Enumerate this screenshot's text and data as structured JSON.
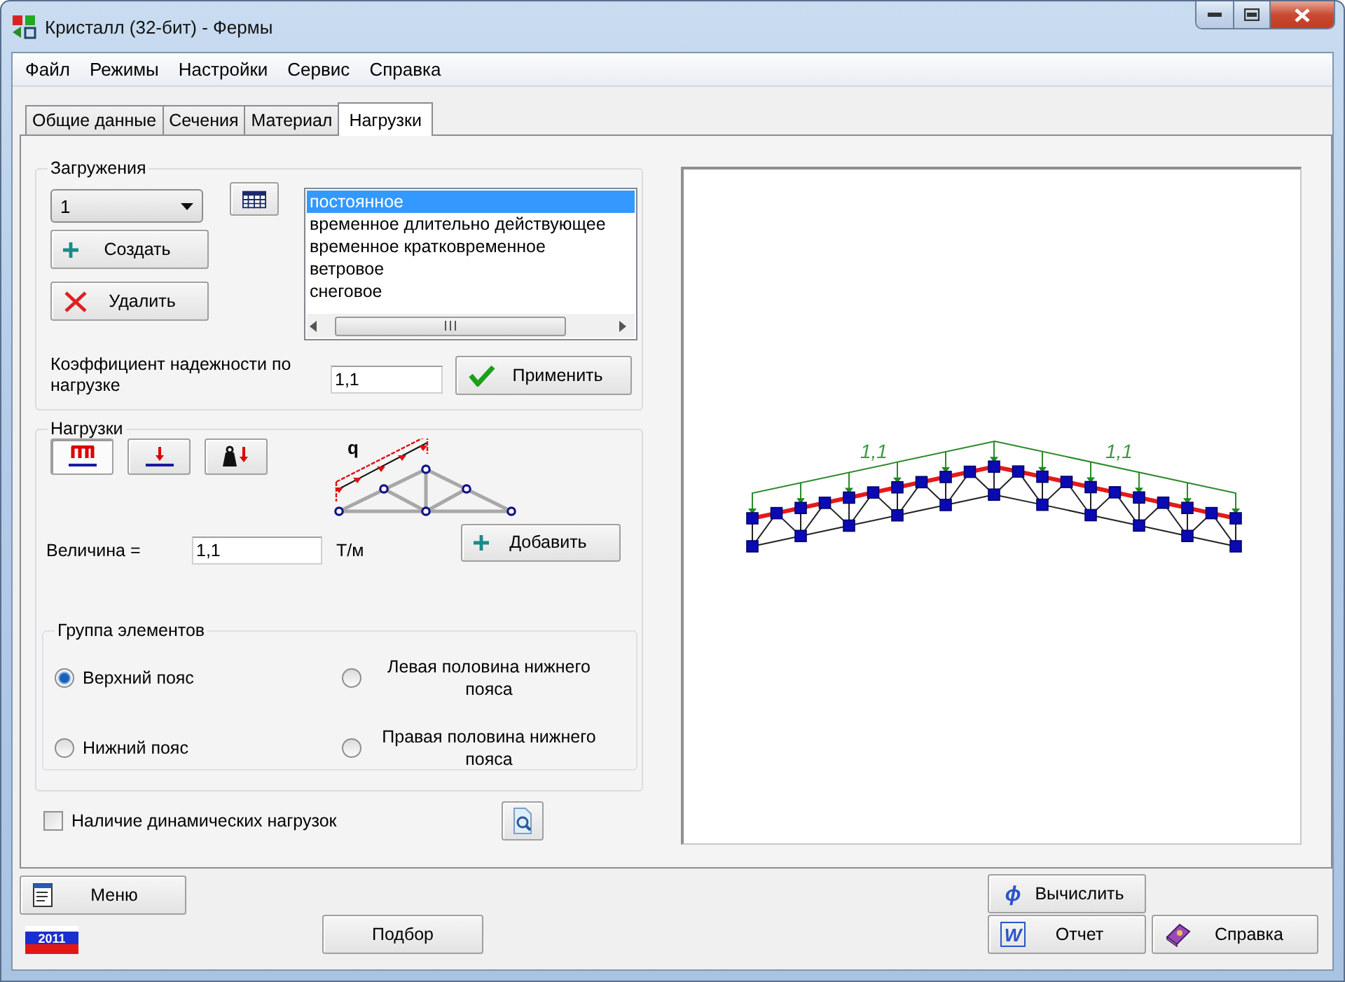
{
  "window": {
    "title": "Кристалл (32-бит) - Фермы"
  },
  "menu": [
    "Файл",
    "Режимы",
    "Настройки",
    "Сервис",
    "Справка"
  ],
  "tabs": [
    {
      "label": "Общие данные",
      "selected": false
    },
    {
      "label": "Сечения",
      "selected": false
    },
    {
      "label": "Материал",
      "selected": false
    },
    {
      "label": "Нагрузки",
      "selected": true
    }
  ],
  "loadings": {
    "title": "Загружения",
    "combo_value": "1",
    "create_button": "Создать",
    "delete_button": "Удалить",
    "load_types": [
      {
        "label": "постоянное",
        "selected": true
      },
      {
        "label": "временное длительно действующее",
        "selected": false
      },
      {
        "label": "временное кратковременное",
        "selected": false
      },
      {
        "label": "ветровое",
        "selected": false
      },
      {
        "label": "снеговое",
        "selected": false
      }
    ],
    "factor_label": "Коэффициент надежности по нагрузке",
    "factor_value": "1,1",
    "apply_button": "Применить"
  },
  "loads": {
    "title": "Нагрузки",
    "load_kinds": [
      {
        "kind": "distributed",
        "selected": true
      },
      {
        "kind": "point",
        "selected": false
      },
      {
        "kind": "weight",
        "selected": false
      }
    ],
    "diagram_label": "q",
    "value_label": "Величина =",
    "value": "1,1",
    "unit": "Т/м",
    "add_button": "Добавить",
    "element_group": {
      "title": "Группа элементов",
      "options": [
        {
          "label": "Верхний пояс",
          "selected": true
        },
        {
          "label": "Левая половина нижнего пояса",
          "selected": false
        },
        {
          "label": "Нижний пояс",
          "selected": false
        },
        {
          "label": "Правая половина нижнего пояса",
          "selected": false
        }
      ]
    }
  },
  "dynamic_loads": {
    "label": "Наличие динамических нагрузок",
    "checked": false
  },
  "preview": {
    "load_labels": [
      "1,1",
      "1,1"
    ]
  },
  "footer": {
    "menu_button": "Меню",
    "year_badge": "2011",
    "select_button": "Подбор",
    "calculate_symbol": "ϕ",
    "calculate_button": "Вычислить",
    "report_symbol": "W",
    "report_button": "Отчет",
    "help_button": "Справка"
  }
}
